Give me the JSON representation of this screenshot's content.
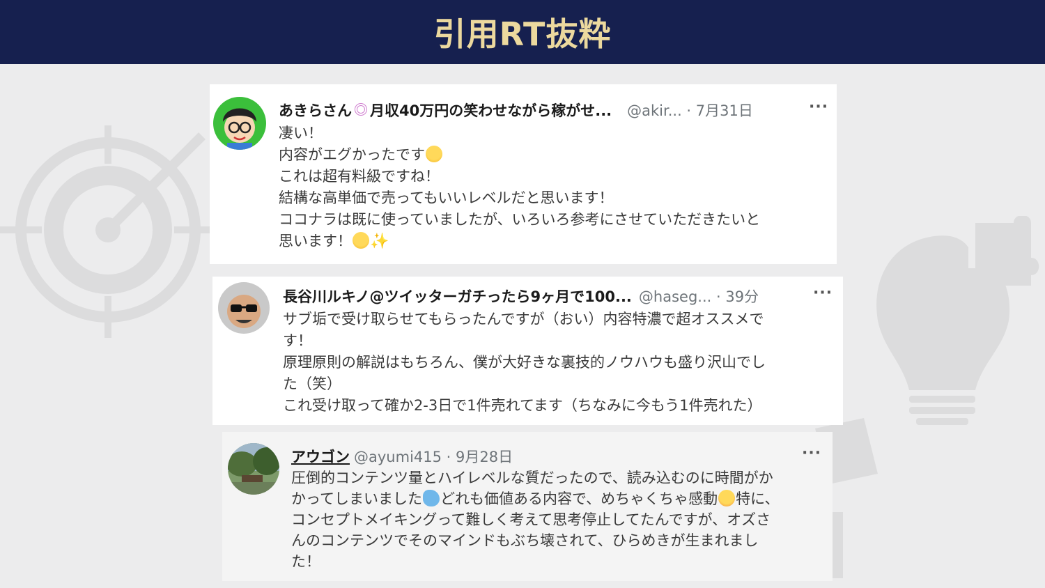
{
  "header": {
    "title": "引用RT抜粋"
  },
  "colors": {
    "header_bg": "#16204f",
    "title": "#ecd99e",
    "page_bg": "#ececed"
  },
  "tweets": [
    {
      "name": "あきらさん",
      "name_suffix": "月収40万円の笑わせながら稼がせ...",
      "handle": "@akir... · 7月31日",
      "more": "···",
      "lines": [
        "凄い！",
        "内容がエグかったです",
        "これは超有料級ですね！",
        "結構な高単価で売ってもいいレベルだと思います！",
        "ココナラは既に使っていましたが、いろいろ参考にさせていただきたいと",
        "思います！"
      ]
    },
    {
      "name": "長谷川ルキノ@ツイッターガチったら9ヶ月で100...",
      "handle": "@haseg... · 39分",
      "more": "···",
      "lines": [
        "サブ垢で受け取らせてもらったんですが（おい）内容特濃で超オススメで",
        "す！",
        "原理原則の解説はもちろん、僕が大好きな裏技的ノウハウも盛り沢山でし",
        "た（笑）",
        "これ受け取って確か2-3日で1件売れてます（ちなみに今もう1件売れた）"
      ]
    },
    {
      "name": "アウゴン",
      "handle": "@ayumi415 · 9月28日",
      "more": "···",
      "lines": [
        "圧倒的コンテンツ量とハイレベルな質だったので、読み込むのに時間がか",
        "かってしまいました",
        "どれも価値ある内容で、めちゃくちゃ感動",
        "特に、",
        "コンセプトメイキングって難しく考えて思考停止してたんですが、オズさ",
        "んのコンテンツでそのマインドもぶち壊されて、ひらめきが生まれまし",
        "た！"
      ]
    }
  ]
}
